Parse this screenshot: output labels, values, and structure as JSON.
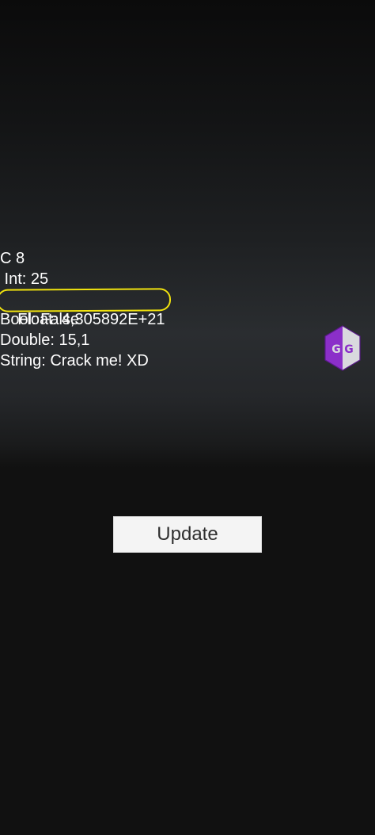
{
  "stats": {
    "lines": [
      "C 8",
      " Int: 25",
      "Float: 4,305892E+21",
      "Bool: False",
      "Double: 15,1",
      "String: Crack me! XD"
    ]
  },
  "overlay": {
    "icon": "gameguardian-icon",
    "logo_text": "GG"
  },
  "update_button": {
    "label": "Update"
  },
  "colors": {
    "highlight": "#f1e30e",
    "logo_purple": "#8b2fc9",
    "logo_gray": "#d9d9de",
    "button_bg": "#f4f4f4",
    "button_text": "#2f2f2f"
  }
}
